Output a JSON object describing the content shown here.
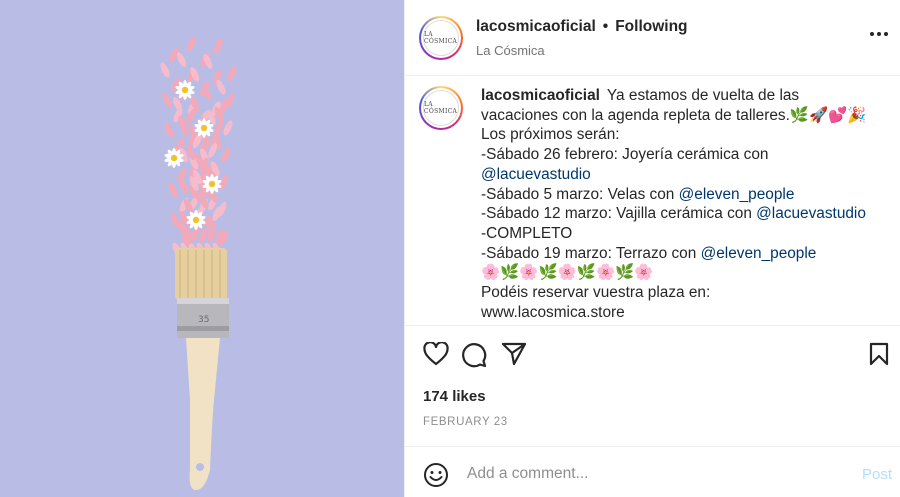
{
  "header": {
    "username": "lacosmicaoficial",
    "separator": "•",
    "follow_status": "Following",
    "location": "La Cósmica",
    "avatar_logo": "LA CÓSMICA"
  },
  "caption": {
    "username": "lacosmicaoficial",
    "lines": [
      {
        "text": "Ya estamos de vuelta de las"
      },
      {
        "text": "vacaciones con la agenda repleta de talleres.🌿🚀💕🎉"
      },
      {
        "text": "Los próximos serán:"
      },
      {
        "text": "-Sábado 26 febrero: Joyería cerámica con"
      },
      {
        "mention": "@lacuevastudio"
      },
      {
        "text": "-Sábado 5 marzo: Velas con ",
        "mention": "@eleven_people"
      },
      {
        "text": "-Sábado 12 marzo: Vajilla cerámica con ",
        "mention": "@lacuevastudio"
      },
      {
        "text": "-COMPLETO"
      },
      {
        "text": "-Sábado 19 marzo: Terrazo con ",
        "mention": "@eleven_people"
      },
      {
        "text": "🌸🌿🌸🌿🌸🌿🌸🌿🌸"
      },
      {
        "text": "Podéis reservar vuestra plaza en:"
      },
      {
        "text": "www.lacosmica.store"
      }
    ]
  },
  "actions": {
    "icons": [
      "heart-icon",
      "comment-icon",
      "share-icon",
      "bookmark-icon"
    ]
  },
  "likes": "174 likes",
  "date": "FEBRUARY 23",
  "comment": {
    "placeholder": "Add a comment...",
    "post_label": "Post"
  },
  "colors": {
    "background_image": "#b9bde6",
    "mention": "#00376b",
    "post_disabled": "#b2dffc",
    "secondary_text": "#8e8e8e"
  }
}
